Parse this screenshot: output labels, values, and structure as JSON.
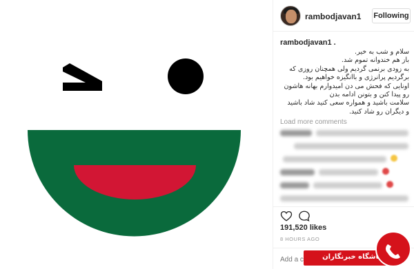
{
  "header": {
    "username": "rambodjavan1",
    "follow_label": "Following"
  },
  "caption": {
    "username": "rambodjavan1 .",
    "lines": [
      "سلام و شب به خیر.",
      "باز هم خندوانه تموم شد.",
      "به زودی برنمی گردیم ولی همچنان روزی که",
      "برگردیم پرانرژی و باانگیزه خواهیم بود.",
      "اونایی که فحش می دن امیدوارم بهانه هاشون",
      "رو پیدا کنن و بتونن ادامه بدن",
      "سلامت باشید و همواره سعی کنید شاد باشید",
      "و دیگران رو شاد کنید."
    ]
  },
  "load_more_label": "Load more comments",
  "likes": "191,520 likes",
  "timestamp": "8 HOURS AGO",
  "add_comment_placeholder": "Add a comme",
  "watermark": {
    "text": "باشگاه خبرنگاران"
  },
  "icons": {
    "like": "heart-icon",
    "comment": "comment-bubble-icon"
  },
  "colors": {
    "smile_green": "#0a6a3c",
    "smile_red": "#d21634",
    "eye_black": "#000000",
    "brand_red": "#d5121b"
  }
}
